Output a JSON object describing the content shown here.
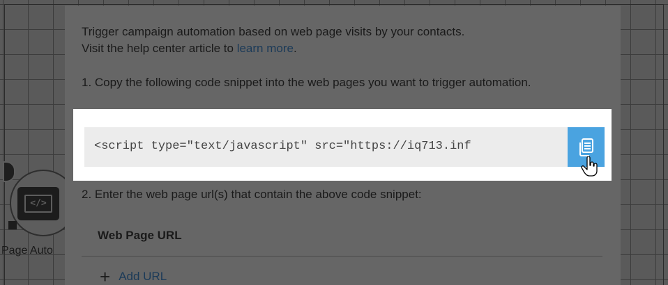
{
  "background_node": {
    "label": "Page Auto",
    "icon": "code-tag-icon",
    "icon_text": "</>"
  },
  "modal": {
    "intro_text": "Trigger campaign automation based on web page visits by your contacts.",
    "intro_text_2": "Visit the help center article to ",
    "learn_more_link": "learn more",
    "intro_period": ".",
    "step1": "1. Copy the following code snippet into the web pages you want to trigger automation.",
    "code_snippet": "<script type=\"text/javascript\" src=\"https://iq713.inf",
    "copy_button_icon": "copy-clipboard-icon",
    "step2": "2. Enter the web page url(s) that contain the above code snippet:",
    "url_table_header": "Web Page URL",
    "add_url_label": "Add URL",
    "add_url_icon": "plus-icon"
  },
  "colors": {
    "overlay": "#5a5a5a",
    "modal_background": "#666666",
    "highlight": "#ffffff",
    "code_background": "#ececec",
    "copy_button": "#4aa3e0",
    "link": "#1b3a58"
  }
}
